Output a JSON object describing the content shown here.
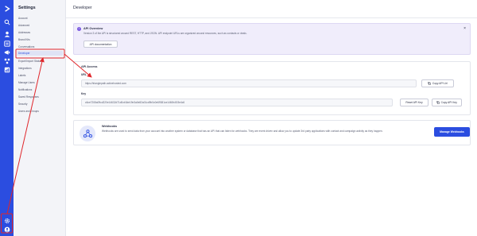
{
  "rail": {
    "icons": [
      "logo-icon",
      "search-icon",
      "contacts-icon",
      "lists-icon",
      "campaigns-icon",
      "automations-icon",
      "reports-icon"
    ],
    "settings_icon": "gear-icon",
    "avatar_icon": "avatar-icon",
    "accent": "#2b4de0"
  },
  "sidebar": {
    "title": "Settings",
    "items": [
      {
        "label": "Account"
      },
      {
        "label": "Advanced"
      },
      {
        "label": "Addresses"
      },
      {
        "label": "Brand Kits"
      },
      {
        "label": "Conversations"
      },
      {
        "label": "Developer",
        "active": true
      },
      {
        "label": "Export/Import Status"
      },
      {
        "label": "Integrations"
      },
      {
        "label": "Labels"
      },
      {
        "label": "Manage Users"
      },
      {
        "label": "Notifications"
      },
      {
        "label": "Saved Responses"
      },
      {
        "label": "Security"
      },
      {
        "label": "Users and Groups"
      }
    ]
  },
  "header": {
    "title": "Developer"
  },
  "overview": {
    "title": "API Overview",
    "description": "Version 3 of the API is structured around REST, HTTP, and JSON. API endpoint URLs are organized around resources, such as contacts or deals.",
    "button_label": "API documentation",
    "close_label": "×"
  },
  "api_access": {
    "title": "API Access",
    "url_label": "URL",
    "url_value": "https://trianglepath.activehosted.com",
    "copy_url_label": "Copy API Url",
    "key_label": "Key",
    "key_value": "c6ce7208a09cd220e14632d71d0cb3de19e3a0e82a01cd9b0c0e69381ce1460fc003e4c6",
    "reset_key_label": "Reset API Key",
    "copy_key_label": "Copy API Key"
  },
  "webhooks": {
    "title": "Webhooks",
    "description": "Webhooks are used to send data from your account into another system or database that has an API that can listen for webhooks. They are event driven and allow you to update 3rd party applications with contact and campaign activity as they happen.",
    "button_label": "Manage Webhooks"
  },
  "colors": {
    "annotation": "#e0262b",
    "overview_bg": "#f0edfb",
    "primary_button": "#2b4de0"
  }
}
